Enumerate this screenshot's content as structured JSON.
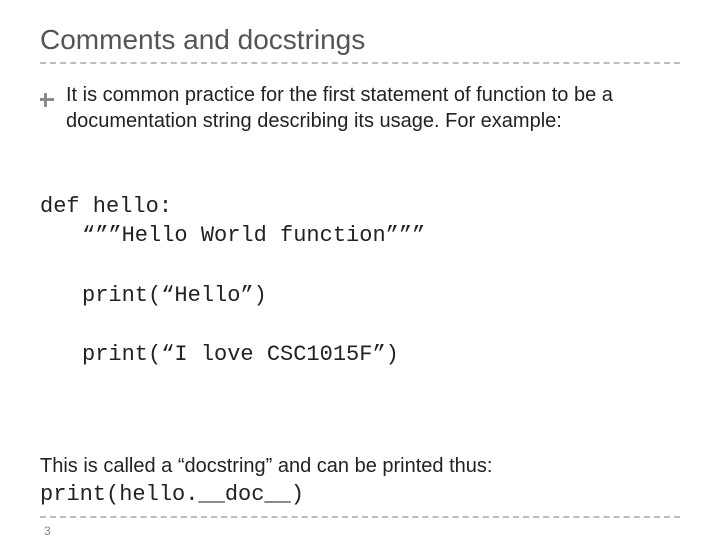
{
  "title": "Comments and docstrings",
  "bullet": "It is common practice for the first statement of function to be a documentation string describing its usage. For example:",
  "code": {
    "l1": "def hello:",
    "l2": "“””Hello World function”””",
    "l3": "print(“Hello”)",
    "l4": "print(“I love CSC1015F”)"
  },
  "closing": "This is called a “docstring” and can be printed thus:",
  "closing_code": "print(hello.__doc__)",
  "page": "3"
}
